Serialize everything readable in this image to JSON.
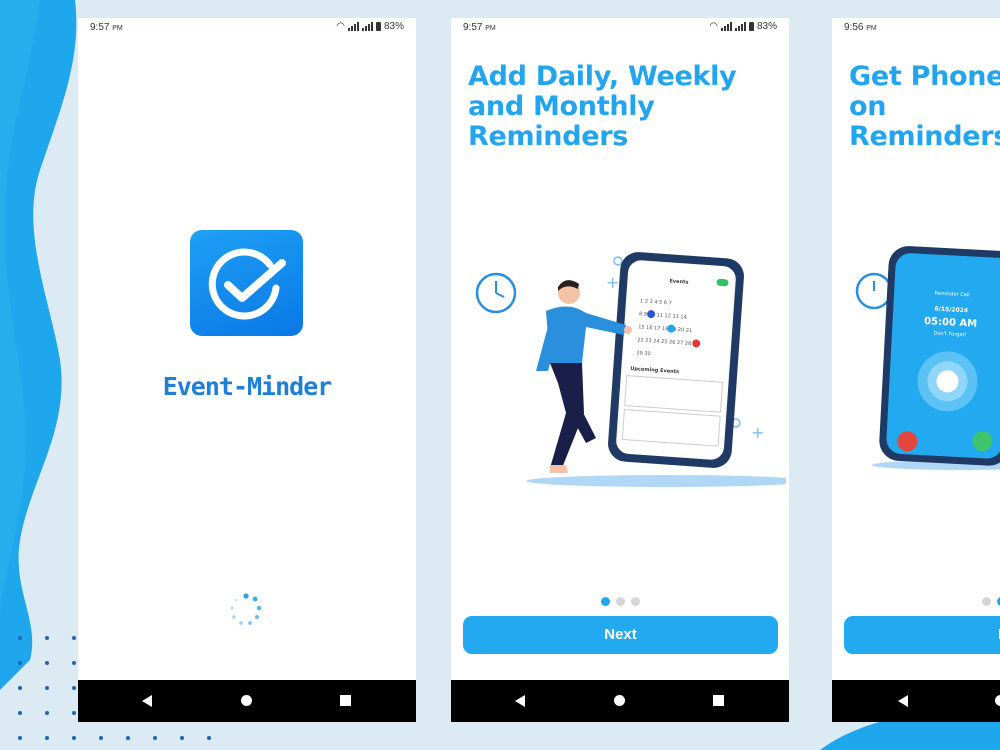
{
  "colors": {
    "accent": "#22a4ee",
    "brand_blue": "#1d7fd6",
    "background": "#dcebf3",
    "nav_bar": "#000000"
  },
  "screens": [
    {
      "status": {
        "time": "9:57",
        "ampm": "PM",
        "battery": "83%"
      },
      "app_icon": "check-circle-icon",
      "app_name": "Event-Minder",
      "loading": "spinner-icon"
    },
    {
      "status": {
        "time": "9:57",
        "ampm": "PM",
        "battery": "83%"
      },
      "title": "Add Daily, Weekly\nand Monthly\nReminders",
      "illustration": "man-pointing-at-calendar-phone",
      "pager": {
        "count": 3,
        "active": 1
      },
      "button": "Next"
    },
    {
      "status": {
        "time": "9:56",
        "ampm": "PM"
      },
      "title": "Get Phone\non\nReminders",
      "illustration": "phone-incoming-call",
      "call_screen": {
        "caller": "Reminder Call",
        "date": "6/15/2024",
        "time": "05:00 AM",
        "note": "Don't Forget!"
      },
      "pager": {
        "count": 3,
        "active": 2
      },
      "button": "Ne"
    }
  ],
  "nav": {
    "back": "back-triangle-icon",
    "home": "home-circle-icon",
    "recent": "recent-square-icon"
  }
}
